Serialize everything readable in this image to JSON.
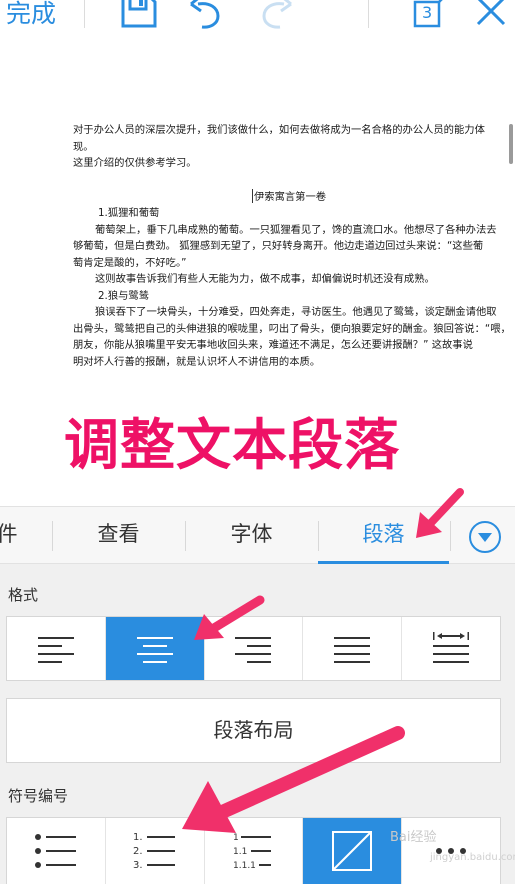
{
  "toolbar": {
    "done_label": "完成",
    "page_count": "3",
    "icons": [
      "save-icon",
      "undo-icon",
      "redo-icon",
      "page-count-icon",
      "close-icon"
    ]
  },
  "document": {
    "lines": [
      "对于办公人员的深层次提升，我们该做什么，如何去做将成为一名合格的办公人员的能力体",
      "现。",
      "这里介绍的仅供参考学习。"
    ],
    "title": "伊索寓言第一卷",
    "story1_heading": "1.狐狸和葡萄",
    "story1_lines": [
      "葡萄架上，垂下几串成熟的葡萄。一只狐狸看见了，馋的直流口水。他想尽了各种办法去",
      "够葡萄，但是白费劲。        狐狸感到无望了，只好转身离开。他边走道边回过头来说：“这些葡",
      "萄肯定是酸的，不好吃。”",
      "这则故事告诉我们有些人无能为力，做不成事，却偏偏说时机还没有成熟。"
    ],
    "story2_heading": "2.狼与鹭鸶",
    "story2_lines": [
      "狼误吞下了一块骨头，十分难受，四处奔走，寻访医生。他遇见了鹭鸶，谈定酬金请他取",
      "出骨头，鹭鸶把自己的头伸进狼的喉咙里，叼出了骨头，便向狼要定好的酬金。狼回答说：“喂，",
      "朋友，你能从狼嘴里平安无事地收回头来，难道还不满足，怎么还要讲报酬？”        这故事说",
      "明对坏人行善的报酬，就是认识坏人不讲信用的本质。"
    ]
  },
  "caption": "调整文本段落",
  "tabs": [
    {
      "label": "件"
    },
    {
      "label": "查看"
    },
    {
      "label": "字体"
    },
    {
      "label": "段落"
    }
  ],
  "active_tab": "段落",
  "panel": {
    "format_label": "格式",
    "align_buttons": [
      "align-left-icon",
      "align-center-icon",
      "align-right-icon",
      "align-justify-icon",
      "align-distributed-icon"
    ],
    "active_align": 1,
    "layout_label": "段落布局",
    "numbering_label": "符号编号",
    "numbering_buttons": [
      "bullet-list-icon",
      "numbered-list-icon",
      "multilevel-list-icon",
      "no-numbering-icon",
      "more-icon"
    ],
    "active_numbering": 3
  },
  "watermark": "Bai经验",
  "watermark_sub": "jingyan.baidu.com",
  "colors": {
    "accent": "#2a8ddf",
    "caption": "#ee1166",
    "arrow": "#f0306a"
  }
}
